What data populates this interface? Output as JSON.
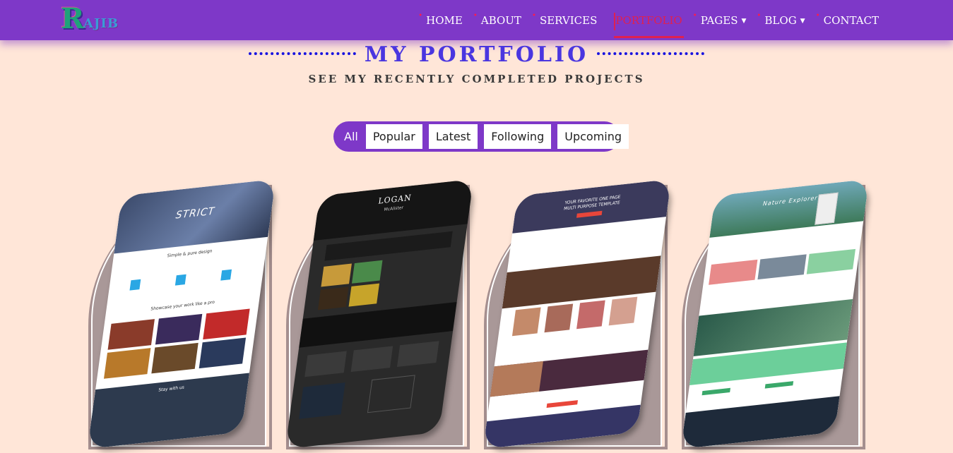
{
  "logo": {
    "big_letter": "R",
    "rest": "AJIB"
  },
  "nav": {
    "items": [
      {
        "label": "HOME",
        "dropdown": false,
        "active": false
      },
      {
        "label": "ABOUT",
        "dropdown": false,
        "active": false
      },
      {
        "label": "SERVICES",
        "dropdown": false,
        "active": false
      },
      {
        "label": "PORTFOLIO",
        "dropdown": false,
        "active": true
      },
      {
        "label": "PAGES",
        "dropdown": true,
        "active": false
      },
      {
        "label": "BLOG",
        "dropdown": true,
        "active": false
      },
      {
        "label": "CONTACT",
        "dropdown": false,
        "active": false
      }
    ]
  },
  "section": {
    "title": "MY PORTFOLIO",
    "subtitle": "SEE MY RECENTLY COMPLETED PROJECTS"
  },
  "filters": {
    "items": [
      "All",
      "Popular",
      "Latest",
      "Following",
      "Upcoming"
    ],
    "active": "All"
  },
  "portfolio": {
    "cards": [
      {
        "heading": "STRICT",
        "sub1": "Simple & pure design",
        "sub2": "Showcase your work like a pro",
        "sub3": "Stay with us"
      },
      {
        "heading": "LOGAN",
        "sub1": "McAlister",
        "sub2": "",
        "sub3": ""
      },
      {
        "heading": "YOUR FAVORITE ONE PAGE",
        "sub1": "MULTI PURPOSE TEMPLATE",
        "sub2": "",
        "sub3": ""
      },
      {
        "heading": "Nature Explorer",
        "sub1": "",
        "sub2": "",
        "sub3": ""
      }
    ]
  },
  "colors": {
    "navbar": "#7e38c8",
    "background": "#ffe6d8",
    "active_nav": "#e02050",
    "title": "#4a36e0"
  }
}
